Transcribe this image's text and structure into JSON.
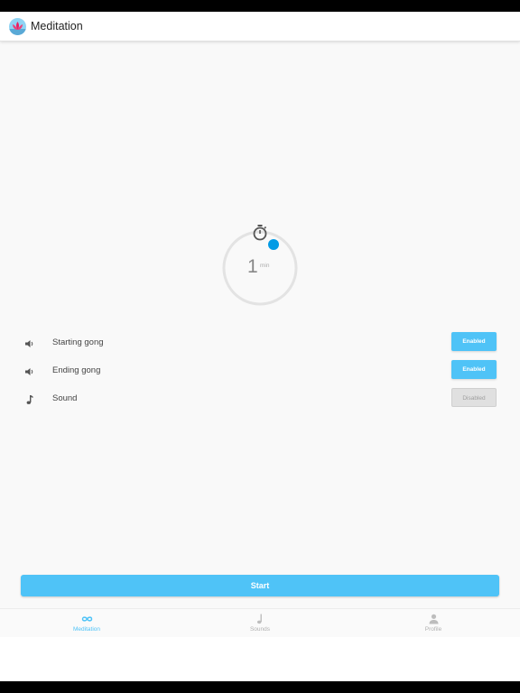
{
  "app": {
    "title": "Meditation",
    "accent_color": "#4fc3f7",
    "logo_icon": "lotus-icon"
  },
  "timer": {
    "value": "1",
    "unit": "min",
    "icon": "stopwatch-icon"
  },
  "settings": [
    {
      "label": "Starting gong",
      "icon": "speaker-icon",
      "state": "Enabled"
    },
    {
      "label": "Ending gong",
      "icon": "speaker-icon",
      "state": "Enabled"
    },
    {
      "label": "Sound",
      "icon": "music-note-icon",
      "state": "Disabled"
    }
  ],
  "actions": {
    "start_label": "Start"
  },
  "tabs": [
    {
      "label": "Meditation",
      "icon": "infinity-icon",
      "active": true
    },
    {
      "label": "Sounds",
      "icon": "music-note-icon",
      "active": false
    },
    {
      "label": "Profile",
      "icon": "person-icon",
      "active": false
    }
  ]
}
